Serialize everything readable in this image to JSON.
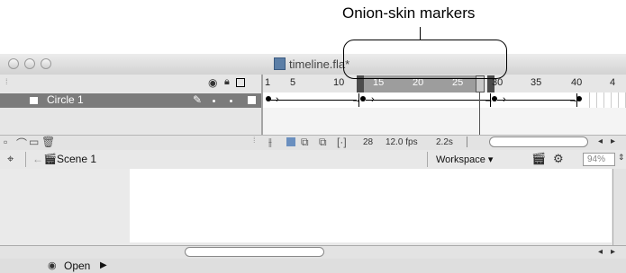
{
  "annotation": {
    "label": "Onion-skin markers"
  },
  "window": {
    "title": "timeline.fla*"
  },
  "timeline": {
    "ruler_numbers": [
      "1",
      "5",
      "10",
      "15",
      "20",
      "25",
      "30",
      "35",
      "40",
      "4"
    ],
    "layer_name": "Circle 1",
    "current_frame": "28",
    "frame_rate": "12.0 fps",
    "elapsed_time": "2.2s"
  },
  "editbar": {
    "scene": "Scene 1",
    "workspace": "Workspace ▾",
    "zoom": "94%"
  },
  "properties": {
    "open_label": "Open"
  },
  "icons": [
    "close-light-icon",
    "minimize-light-icon",
    "zoom-light-icon",
    "document-icon",
    "eye-icon",
    "lock-icon",
    "outline-icon",
    "layer-icon",
    "pencil-icon",
    "add-layer-icon",
    "add-guide-icon",
    "add-folder-icon",
    "delete-layer-icon",
    "center-frame-icon",
    "onion-skin-icon",
    "onion-outline-icon",
    "edit-multiple-icon",
    "modify-markers-icon",
    "stage-icon",
    "back-arrow-icon",
    "scene-icon",
    "edit-scene-icon",
    "edit-symbol-icon",
    "collapse-triangle-icon",
    "expand-triangle-icon"
  ],
  "colors": {
    "layer_selected": "#7b7b7b",
    "onion_range": "#9d9d9d",
    "titlebar": "#d8d8d8"
  }
}
